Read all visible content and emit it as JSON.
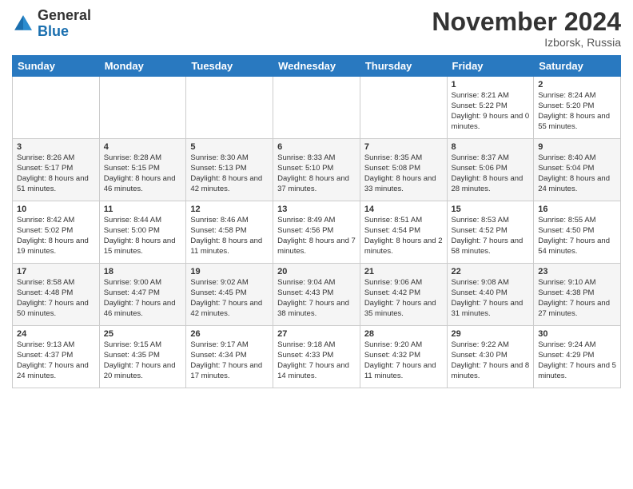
{
  "header": {
    "logo_general": "General",
    "logo_blue": "Blue",
    "month_title": "November 2024",
    "location": "Izborsk, Russia"
  },
  "days_of_week": [
    "Sunday",
    "Monday",
    "Tuesday",
    "Wednesday",
    "Thursday",
    "Friday",
    "Saturday"
  ],
  "weeks": [
    [
      {
        "day": "",
        "info": ""
      },
      {
        "day": "",
        "info": ""
      },
      {
        "day": "",
        "info": ""
      },
      {
        "day": "",
        "info": ""
      },
      {
        "day": "",
        "info": ""
      },
      {
        "day": "1",
        "info": "Sunrise: 8:21 AM\nSunset: 5:22 PM\nDaylight: 9 hours\nand 0 minutes."
      },
      {
        "day": "2",
        "info": "Sunrise: 8:24 AM\nSunset: 5:20 PM\nDaylight: 8 hours\nand 55 minutes."
      }
    ],
    [
      {
        "day": "3",
        "info": "Sunrise: 8:26 AM\nSunset: 5:17 PM\nDaylight: 8 hours\nand 51 minutes."
      },
      {
        "day": "4",
        "info": "Sunrise: 8:28 AM\nSunset: 5:15 PM\nDaylight: 8 hours\nand 46 minutes."
      },
      {
        "day": "5",
        "info": "Sunrise: 8:30 AM\nSunset: 5:13 PM\nDaylight: 8 hours\nand 42 minutes."
      },
      {
        "day": "6",
        "info": "Sunrise: 8:33 AM\nSunset: 5:10 PM\nDaylight: 8 hours\nand 37 minutes."
      },
      {
        "day": "7",
        "info": "Sunrise: 8:35 AM\nSunset: 5:08 PM\nDaylight: 8 hours\nand 33 minutes."
      },
      {
        "day": "8",
        "info": "Sunrise: 8:37 AM\nSunset: 5:06 PM\nDaylight: 8 hours\nand 28 minutes."
      },
      {
        "day": "9",
        "info": "Sunrise: 8:40 AM\nSunset: 5:04 PM\nDaylight: 8 hours\nand 24 minutes."
      }
    ],
    [
      {
        "day": "10",
        "info": "Sunrise: 8:42 AM\nSunset: 5:02 PM\nDaylight: 8 hours\nand 19 minutes."
      },
      {
        "day": "11",
        "info": "Sunrise: 8:44 AM\nSunset: 5:00 PM\nDaylight: 8 hours\nand 15 minutes."
      },
      {
        "day": "12",
        "info": "Sunrise: 8:46 AM\nSunset: 4:58 PM\nDaylight: 8 hours\nand 11 minutes."
      },
      {
        "day": "13",
        "info": "Sunrise: 8:49 AM\nSunset: 4:56 PM\nDaylight: 8 hours\nand 7 minutes."
      },
      {
        "day": "14",
        "info": "Sunrise: 8:51 AM\nSunset: 4:54 PM\nDaylight: 8 hours\nand 2 minutes."
      },
      {
        "day": "15",
        "info": "Sunrise: 8:53 AM\nSunset: 4:52 PM\nDaylight: 7 hours\nand 58 minutes."
      },
      {
        "day": "16",
        "info": "Sunrise: 8:55 AM\nSunset: 4:50 PM\nDaylight: 7 hours\nand 54 minutes."
      }
    ],
    [
      {
        "day": "17",
        "info": "Sunrise: 8:58 AM\nSunset: 4:48 PM\nDaylight: 7 hours\nand 50 minutes."
      },
      {
        "day": "18",
        "info": "Sunrise: 9:00 AM\nSunset: 4:47 PM\nDaylight: 7 hours\nand 46 minutes."
      },
      {
        "day": "19",
        "info": "Sunrise: 9:02 AM\nSunset: 4:45 PM\nDaylight: 7 hours\nand 42 minutes."
      },
      {
        "day": "20",
        "info": "Sunrise: 9:04 AM\nSunset: 4:43 PM\nDaylight: 7 hours\nand 38 minutes."
      },
      {
        "day": "21",
        "info": "Sunrise: 9:06 AM\nSunset: 4:42 PM\nDaylight: 7 hours\nand 35 minutes."
      },
      {
        "day": "22",
        "info": "Sunrise: 9:08 AM\nSunset: 4:40 PM\nDaylight: 7 hours\nand 31 minutes."
      },
      {
        "day": "23",
        "info": "Sunrise: 9:10 AM\nSunset: 4:38 PM\nDaylight: 7 hours\nand 27 minutes."
      }
    ],
    [
      {
        "day": "24",
        "info": "Sunrise: 9:13 AM\nSunset: 4:37 PM\nDaylight: 7 hours\nand 24 minutes."
      },
      {
        "day": "25",
        "info": "Sunrise: 9:15 AM\nSunset: 4:35 PM\nDaylight: 7 hours\nand 20 minutes."
      },
      {
        "day": "26",
        "info": "Sunrise: 9:17 AM\nSunset: 4:34 PM\nDaylight: 7 hours\nand 17 minutes."
      },
      {
        "day": "27",
        "info": "Sunrise: 9:18 AM\nSunset: 4:33 PM\nDaylight: 7 hours\nand 14 minutes."
      },
      {
        "day": "28",
        "info": "Sunrise: 9:20 AM\nSunset: 4:32 PM\nDaylight: 7 hours\nand 11 minutes."
      },
      {
        "day": "29",
        "info": "Sunrise: 9:22 AM\nSunset: 4:30 PM\nDaylight: 7 hours\nand 8 minutes."
      },
      {
        "day": "30",
        "info": "Sunrise: 9:24 AM\nSunset: 4:29 PM\nDaylight: 7 hours\nand 5 minutes."
      }
    ]
  ]
}
